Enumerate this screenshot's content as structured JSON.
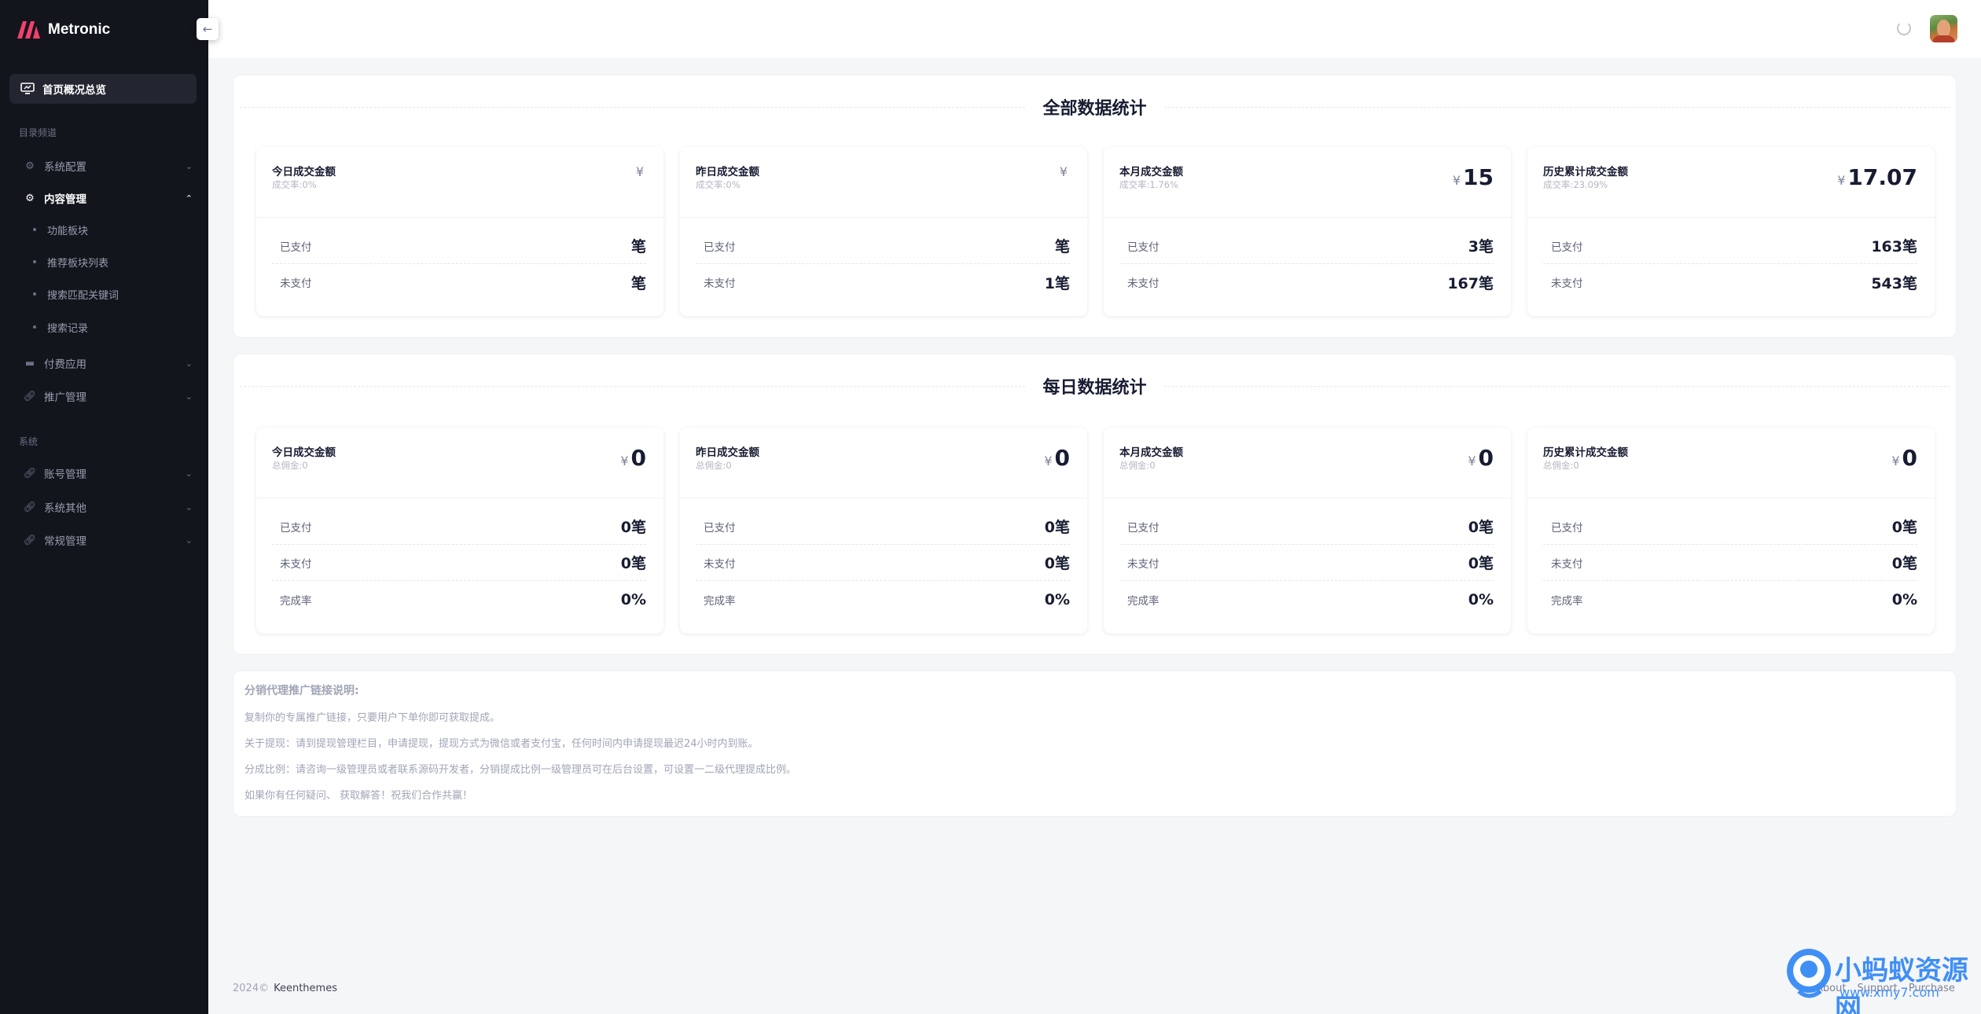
{
  "app": {
    "brand": "Metronic",
    "colors": {
      "sidebar": "#13151d",
      "accent_logo": "#f1416c",
      "watermark": "#3f8ff5"
    }
  },
  "sidebar": {
    "active_item": {
      "label": "首页概况总览",
      "icon": "monitor-icon"
    },
    "sections": [
      {
        "title": "目录频道",
        "items": [
          {
            "label": "系统配置",
            "icon": "gear-icon",
            "open": false
          },
          {
            "label": "内容管理",
            "icon": "gear-icon",
            "open": true,
            "children": [
              "功能板块",
              "推荐板块列表",
              "搜索匹配关键词",
              "搜索记录"
            ]
          },
          {
            "label": "付费应用",
            "icon": "wallet-icon",
            "open": false
          },
          {
            "label": "推广管理",
            "icon": "link-icon",
            "open": false
          }
        ]
      },
      {
        "title": "系统",
        "items": [
          {
            "label": "账号管理",
            "icon": "link-icon",
            "open": false
          },
          {
            "label": "系统其他",
            "icon": "link-icon",
            "open": false
          },
          {
            "label": "常规管理",
            "icon": "link-icon",
            "open": false
          }
        ]
      }
    ]
  },
  "header": {
    "collapse_icon": "arrow-left-icon",
    "loader_icon": "spinner-icon",
    "avatar": "user-avatar"
  },
  "all_stats": {
    "title": "全部数据统计",
    "cards": [
      {
        "name": "今日成交金额",
        "sub": "成交率:0%",
        "currency": "¥",
        "amount": "",
        "rows": [
          {
            "label": "已支付",
            "value": "笔"
          },
          {
            "label": "未支付",
            "value": "笔"
          }
        ]
      },
      {
        "name": "昨日成交金额",
        "sub": "成交率:0%",
        "currency": "¥",
        "amount": "",
        "rows": [
          {
            "label": "已支付",
            "value": "笔"
          },
          {
            "label": "未支付",
            "value": "1笔"
          }
        ]
      },
      {
        "name": "本月成交金额",
        "sub": "成交率:1.76%",
        "currency": "¥",
        "amount": "15",
        "rows": [
          {
            "label": "已支付",
            "value": "3笔"
          },
          {
            "label": "未支付",
            "value": "167笔"
          }
        ]
      },
      {
        "name": "历史累计成交金额",
        "sub": "成交率:23.09%",
        "currency": "¥",
        "amount": "17.07",
        "rows": [
          {
            "label": "已支付",
            "value": "163笔"
          },
          {
            "label": "未支付",
            "value": "543笔"
          }
        ]
      }
    ]
  },
  "daily_stats": {
    "title": "每日数据统计",
    "cards": [
      {
        "name": "今日成交金额",
        "sub": "总佣金:0",
        "currency": "¥",
        "amount": "0",
        "rows": [
          {
            "label": "已支付",
            "value": "0笔"
          },
          {
            "label": "未支付",
            "value": "0笔"
          },
          {
            "label": "完成率",
            "value": "0%"
          }
        ]
      },
      {
        "name": "昨日成交金额",
        "sub": "总佣金:0",
        "currency": "¥",
        "amount": "0",
        "rows": [
          {
            "label": "已支付",
            "value": "0笔"
          },
          {
            "label": "未支付",
            "value": "0笔"
          },
          {
            "label": "完成率",
            "value": "0%"
          }
        ]
      },
      {
        "name": "本月成交金额",
        "sub": "总佣金:0",
        "currency": "¥",
        "amount": "0",
        "rows": [
          {
            "label": "已支付",
            "value": "0笔"
          },
          {
            "label": "未支付",
            "value": "0笔"
          },
          {
            "label": "完成率",
            "value": "0%"
          }
        ]
      },
      {
        "name": "历史累计成交金额",
        "sub": "总佣金:0",
        "currency": "¥",
        "amount": "0",
        "rows": [
          {
            "label": "已支付",
            "value": "0笔"
          },
          {
            "label": "未支付",
            "value": "0笔"
          },
          {
            "label": "完成率",
            "value": "0%"
          }
        ]
      }
    ]
  },
  "notes": {
    "title": "分销代理推广链接说明:",
    "lines": [
      "复制你的专属推广链接，只要用户下单你即可获取提成。",
      "关于提现：请到提现管理栏目，申请提现，提现方式为微信或者支付宝，任何时间内申请提现最迟24小时内到账。",
      "分成比例：请咨询一级管理员或者联系源码开发者，分销提成比例一级管理员可在后台设置，可设置一二级代理提成比例。",
      "如果你有任何疑问、 获取解答！祝我们合作共赢！"
    ]
  },
  "footer": {
    "copyright": "2024©",
    "brand": "Keenthemes",
    "links": [
      "About",
      "Support",
      "Purchase"
    ]
  },
  "watermark": {
    "text": "小蚂蚁资源网",
    "url": "www.xmy7.com"
  }
}
